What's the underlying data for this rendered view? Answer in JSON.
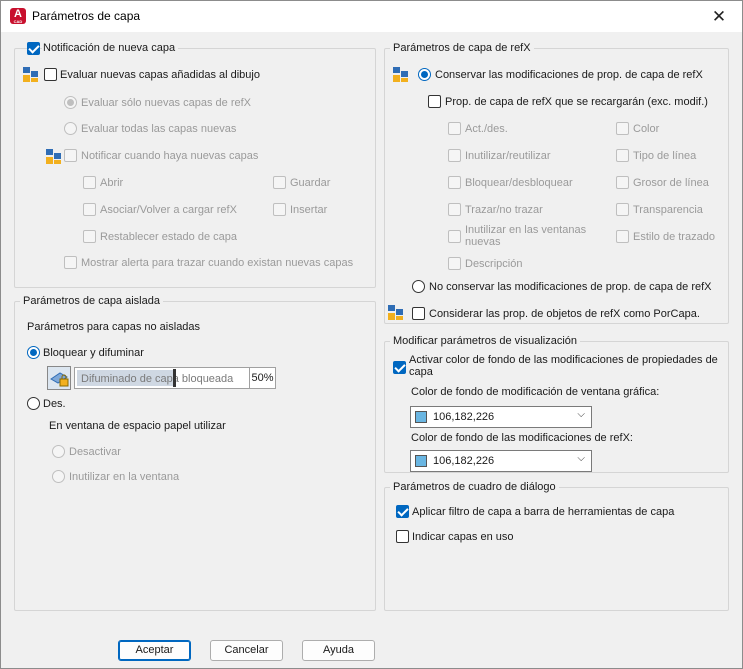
{
  "window": {
    "title": "Parámetros de capa",
    "app_icon_letter": "A",
    "app_icon_sub": "CAD",
    "close_glyph": "✕"
  },
  "new_layer_notification": {
    "group_label": "Notificación de nueva capa",
    "group_checked": true,
    "evaluate": {
      "label": "Evaluar nuevas capas añadidas al dibujo",
      "checked": false
    },
    "eval_xref_only": {
      "label": "Evaluar sólo nuevas capas de refX",
      "selected": true
    },
    "eval_all": {
      "label": "Evaluar todas las capas nuevas",
      "selected": false
    },
    "notify": {
      "label": "Notificar cuando haya nuevas capas",
      "checked": false
    },
    "open": {
      "label": "Abrir"
    },
    "save": {
      "label": "Guardar"
    },
    "attach": {
      "label": "Asociar/Volver a cargar refX"
    },
    "insert": {
      "label": "Insertar"
    },
    "restore": {
      "label": "Restablecer estado de capa"
    },
    "plot_alert": {
      "label": "Mostrar alerta para trazar cuando existan nuevas capas"
    }
  },
  "isolate": {
    "group_label": "Parámetros de capa aislada",
    "subtitle": "Parámetros para capas no aisladas",
    "lock_fade": {
      "label": "Bloquear y difuminar",
      "selected": true
    },
    "fade_label": "Difuminado de capa bloqueada",
    "fade_value": "50%",
    "off": {
      "label": "Des.",
      "selected": false
    },
    "paper_label": "En ventana de espacio papel utilizar",
    "deactivate": {
      "label": "Desactivar",
      "selected": true
    },
    "vp_freeze": {
      "label": "Inutilizar en la ventana",
      "selected": false
    }
  },
  "xref": {
    "group_label": "Parámetros de capa de refX",
    "keep_changes": {
      "label": "Conservar las modificaciones de prop. de capa de refX",
      "selected": true
    },
    "reload_props": {
      "label": "Prop. de capa de refX que se recargarán (exc. modif.)",
      "checked": false
    },
    "props_left": [
      {
        "name": "prop-on-off",
        "label": "Act./des."
      },
      {
        "name": "prop-freeze",
        "label": "Inutilizar/reutilizar"
      },
      {
        "name": "prop-lock",
        "label": "Bloquear/desbloquear"
      },
      {
        "name": "prop-plot",
        "label": "Trazar/no trazar"
      },
      {
        "name": "prop-vp-freeze",
        "label": "Inutilizar en las ventanas nuevas"
      },
      {
        "name": "prop-description",
        "label": "Descripción"
      }
    ],
    "props_right": [
      {
        "name": "prop-color",
        "label": "Color"
      },
      {
        "name": "prop-linetype",
        "label": "Tipo de línea"
      },
      {
        "name": "prop-lineweight",
        "label": "Grosor de línea"
      },
      {
        "name": "prop-transparency",
        "label": "Transparencia"
      },
      {
        "name": "prop-plotstyle",
        "label": "Estilo de trazado"
      }
    ],
    "no_keep": {
      "label": "No conservar las modificaciones de prop. de capa de refX",
      "selected": false
    },
    "bylayer": {
      "label": "Considerar las prop. de objetos de refX como PorCapa.",
      "checked": false
    }
  },
  "override": {
    "group_label": "Modificar parámetros de visualización",
    "enable": {
      "label": "Activar color de fondo de las modificaciones de propiedades de capa",
      "checked": true
    },
    "vp_bg_label": "Color de fondo de modificación de ventana gráfica:",
    "vp_bg_value": "106,182,226",
    "xref_bg_label": "Color de fondo de las modificaciones de refX:",
    "xref_bg_value": "106,182,226",
    "swatch_color": "#6ab6e2"
  },
  "dialog_settings": {
    "group_label": "Parámetros de cuadro de diálogo",
    "apply_filter": {
      "label": "Aplicar filtro de capa a barra de herramientas de capa",
      "checked": true
    },
    "in_use": {
      "label": "Indicar capas en uso",
      "checked": false
    }
  },
  "buttons": {
    "ok": "Aceptar",
    "cancel": "Cancelar",
    "help": "Ayuda"
  },
  "colors": {
    "accent": "#0067c0",
    "app_red": "#c8102e"
  }
}
